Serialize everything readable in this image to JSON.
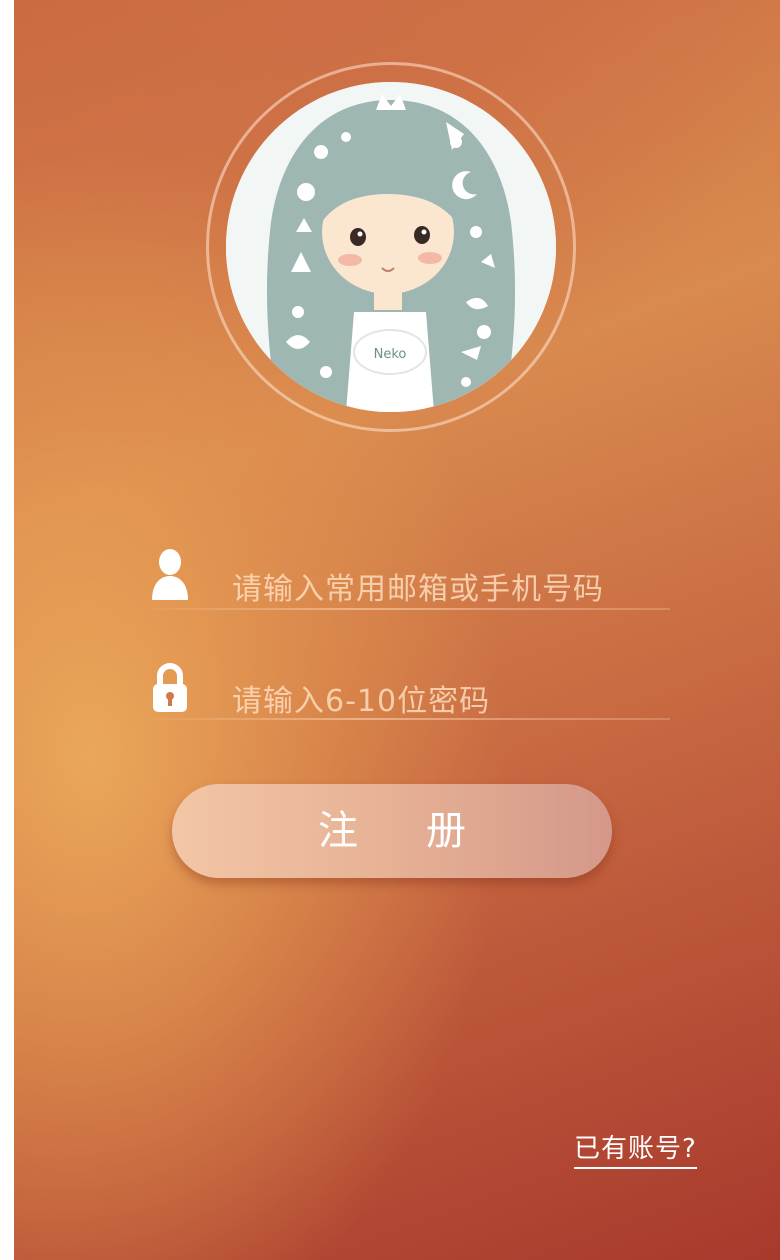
{
  "form": {
    "username_placeholder": "请输入常用邮箱或手机号码",
    "password_placeholder": "请输入6-10位密码",
    "register_label": "注册",
    "have_account_link": "已有账号?"
  },
  "avatar": {
    "badge_text": "Neko"
  },
  "icons": {
    "user": "user-icon",
    "lock": "lock-icon"
  },
  "colors": {
    "background_dark": "#a8392d",
    "background_light": "#e6a45a",
    "button": "#e8b396",
    "hair": "#9fb7b3"
  }
}
